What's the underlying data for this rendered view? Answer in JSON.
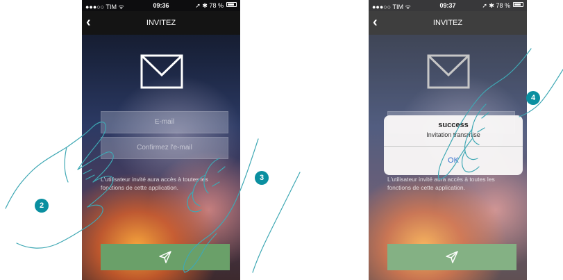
{
  "screens": [
    {
      "status": {
        "carrier": "●●●○○ TIM ᯤ",
        "time": "09:36",
        "battery": "➚ ✱ 78 %"
      },
      "nav": {
        "title": "INVITEZ",
        "back_icon": "chevron-left-icon"
      },
      "form": {
        "email_placeholder": "E-mail",
        "confirm_placeholder": "Confirmez l'e-mail",
        "info_text": "L'utilisateur invité aura accès à toutes les fonctions de cette application."
      },
      "send_icon": "send-icon"
    },
    {
      "status": {
        "carrier": "●●●○○ TIM ᯤ",
        "time": "09:37",
        "battery": "➚ ✱ 78 %"
      },
      "nav": {
        "title": "INVITEZ",
        "back_icon": "chevron-left-icon"
      },
      "form": {
        "info_text": "L'utilisateur invité aura accès à toutes les fonctions de cette application."
      },
      "dialog": {
        "title": "success",
        "message": "Invitation transmise",
        "ok": "OK"
      },
      "send_icon": "send-icon"
    }
  ],
  "steps": [
    "2",
    "3",
    "4"
  ],
  "colors": {
    "send_button": "#6aa069",
    "step_badge": "#0a8fa0",
    "dialog_ok": "#2f6ccc"
  }
}
